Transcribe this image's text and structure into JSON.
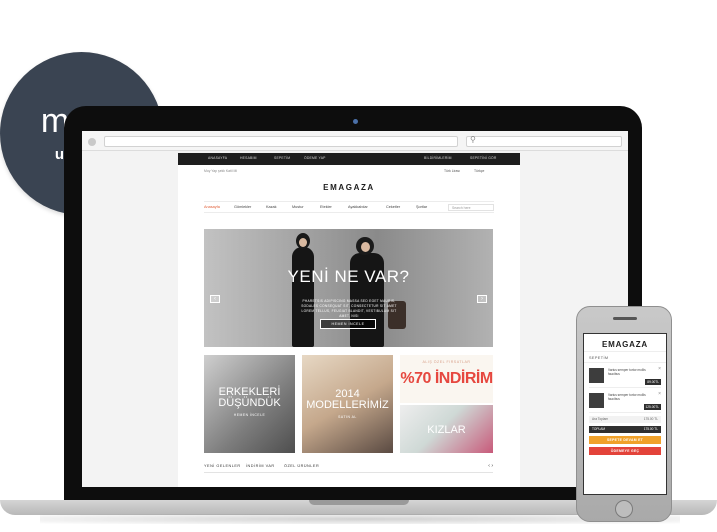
{
  "badge": {
    "line1": "mobil",
    "line2": "uyumlu"
  },
  "browser": {
    "search_icon": "search-icon"
  },
  "site": {
    "topbar": {
      "left": [
        "ANASAYFA",
        "HESABIM",
        "SEPETİM",
        "ÖDEME YAP"
      ],
      "right": [
        "BİLDİRİMLERİM",
        "SEPETİNİ GÖR"
      ]
    },
    "util": {
      "tagline": "Moy Yap şeklı Katil Mi",
      "currency": "Türk Lirası",
      "language": "Türkçe"
    },
    "logo": "EMAGAZA",
    "nav": {
      "items": [
        "Anasayfa",
        "Gömlekler",
        "Kazak",
        "Mustur",
        "Etekler",
        "Ayakkabılar",
        "Ceketler",
        "Şortlar"
      ],
      "search_placeholder": "Search here"
    },
    "hero": {
      "title": "YENİ NE VAR?",
      "text": "PHARETSIS ADIPISCING MASSA SED EGET MAURIS, SODALES CONSEQUAT SIT, CONSECTETUR SIT AMET LOREM TELLUS, FEUGIAT BLANDIT, VESTIBULUM SIT AMET, NISI",
      "button": "HEMEN İNCELE"
    },
    "tiles": {
      "t1_title": "ERKEKLERİ\nDÜŞÜNDÜK",
      "t1_sub": "HEMEN İNCELE",
      "t2_title": "2014\nMODELLERİMİZ",
      "t2_sub": "SATIN AL",
      "t3_small": "ALIŞ ÖZEL FIRSATLAR",
      "t3_big": "%70 İNDİRİM",
      "t4_title": "KIZLAR"
    },
    "footer_tabs": [
      "YENİ GELENLER",
      "İNDİRİM VAR",
      "ÖZEL ÜRÜNLER"
    ],
    "footer_nav": "‹ ›"
  },
  "phone": {
    "logo": "EMAGAZA",
    "cart_title": "SEPETİM",
    "items": [
      {
        "name": "Varius semper tortor mollis faucibus",
        "price": "89.00TL"
      },
      {
        "name": "Varius semper tortor mollis faucibus",
        "price": "125.00TL"
      }
    ],
    "rows": [
      {
        "label": "Ara Toplam",
        "value": "175.00 TL"
      },
      {
        "label": "TOPLAM",
        "value": "175.00 TL"
      }
    ],
    "btn_cart": "SEPETE DEVAM ET",
    "btn_checkout": "ÖDEMEYE GEÇ"
  }
}
